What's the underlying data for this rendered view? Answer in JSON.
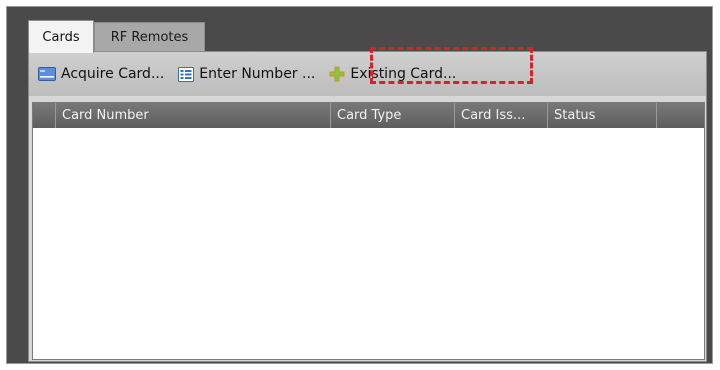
{
  "tabs": [
    {
      "label": "Cards",
      "active": true
    },
    {
      "label": "RF Remotes",
      "active": false
    }
  ],
  "toolbar": {
    "acquire_label": "Acquire Card...",
    "enter_label": "Enter Number ...",
    "existing_label": "Existing Card...",
    "acquire_icon": "card-icon",
    "enter_icon": "keypad-icon",
    "existing_icon": "plus-icon"
  },
  "grid": {
    "columns": [
      "",
      "Card Number",
      "Card Type",
      "Card Iss...",
      "Status",
      ""
    ],
    "rows": []
  },
  "colors": {
    "highlight": "#d6222b",
    "header_bg": "#6b6b6b",
    "frame_bg": "#4a4a4a"
  }
}
